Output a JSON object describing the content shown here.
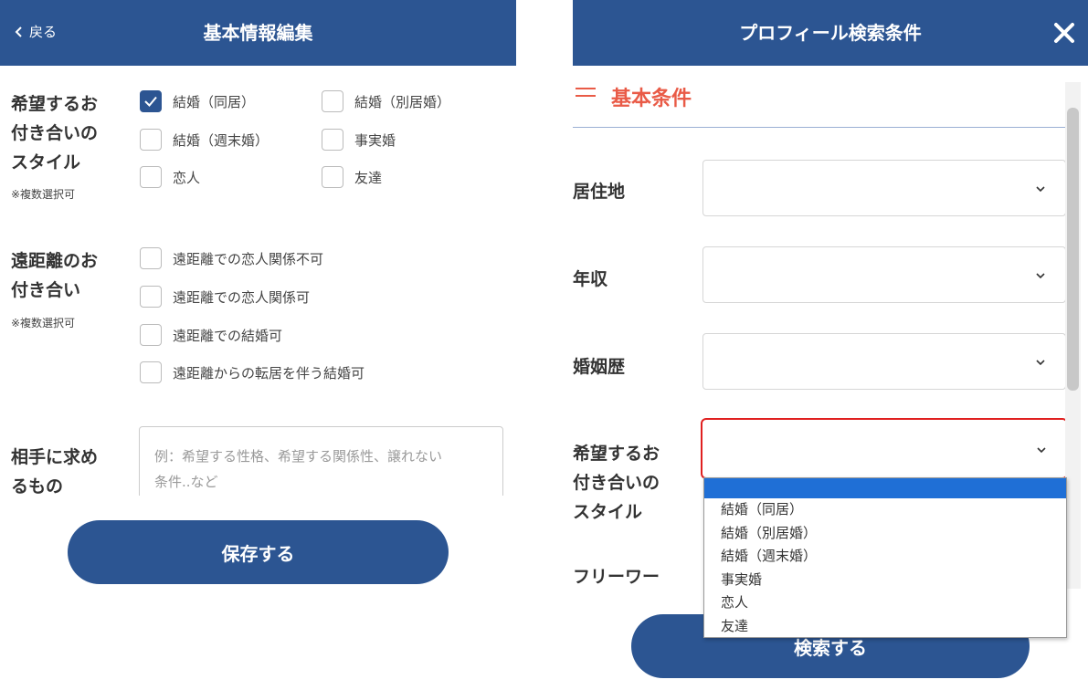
{
  "left": {
    "header": {
      "back": "戻る",
      "title": "基本情報編集"
    },
    "style": {
      "label": [
        "希望するお",
        "付き合いの",
        "スタイル"
      ],
      "note": "※複数選択可",
      "options": [
        {
          "label": "結婚（同居）",
          "checked": true
        },
        {
          "label": "結婚（別居婚）",
          "checked": false
        },
        {
          "label": "結婚（週末婚）",
          "checked": false
        },
        {
          "label": "事実婚",
          "checked": false
        },
        {
          "label": "恋人",
          "checked": false
        },
        {
          "label": "友達",
          "checked": false
        }
      ]
    },
    "distance": {
      "label": [
        "遠距離のお",
        "付き合い"
      ],
      "note": "※複数選択可",
      "options": [
        {
          "label": "遠距離での恋人関係不可",
          "checked": false
        },
        {
          "label": "遠距離での恋人関係可",
          "checked": false
        },
        {
          "label": "遠距離での結婚可",
          "checked": false
        },
        {
          "label": "遠距離からの転居を伴う結婚可",
          "checked": false
        }
      ]
    },
    "wants": {
      "label": [
        "相手に求め",
        "るもの"
      ],
      "placeholder": [
        "例：希望する性格、希望する関係性、譲れない",
        "条件..など"
      ]
    },
    "save": "保存する"
  },
  "right": {
    "header": {
      "title": "プロフィール検索条件"
    },
    "section": "基本条件",
    "fields": {
      "residence": "居住地",
      "income": "年収",
      "marriage": "婚姻歴",
      "style": [
        "希望するお",
        "付き合いの",
        "スタイル"
      ],
      "freeword": "フリーワー"
    },
    "dropdown": [
      "結婚（同居）",
      "結婚（別居婚）",
      "結婚（週末婚）",
      "事実婚",
      "恋人",
      "友達"
    ],
    "search": "検索する"
  },
  "colors": {
    "brand": "#2c5592",
    "accent": "#e95b47",
    "focus": "#e02020",
    "highlight": "#1f6fd6"
  },
  "icons": [
    "chevron-left-icon",
    "close-icon",
    "checkmark-icon",
    "chevron-down-icon",
    "section-bars-icon"
  ]
}
